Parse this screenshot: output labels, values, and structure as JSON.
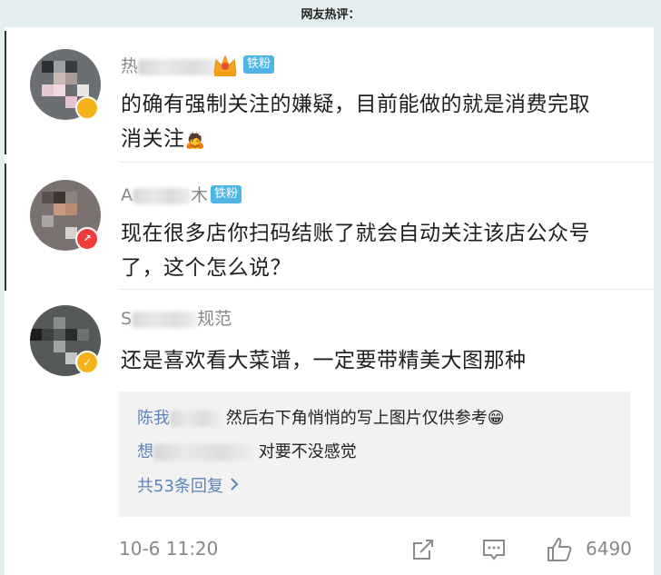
{
  "page": {
    "heading": "网友热评："
  },
  "comments": [
    {
      "name": "热",
      "badge": "铁粉",
      "text_line1": "的确有强制关注的嫌疑，目前能做的就是消费完取",
      "text_line2": "消关注",
      "emoji": "🙇"
    },
    {
      "name_start": "A",
      "name_end": "木",
      "badge": "铁粉",
      "text_line1": "现在很多店你扫码结账了就会自动关注该店公众号",
      "text_line2": "了，这个怎么说？"
    },
    {
      "name_start": "S",
      "name_end": "规范",
      "text": "还是喜欢看大菜谱，一定要带精美大图那种",
      "replies": [
        {
          "name": "陈我",
          "text": "然后右下角悄悄的写上图片仅供参考😁"
        },
        {
          "name": "想",
          "text": "对要不没感觉"
        }
      ],
      "more_replies": "共53条回复",
      "more_icon": "chevron-right-icon",
      "timestamp": "10-6 11:20",
      "like_count": "6490"
    }
  ],
  "icons": {
    "share": "share-icon",
    "comment": "comment-icon",
    "like": "thumbs-up-icon"
  },
  "colors": {
    "badge_bg": "#4eb5e6",
    "link": "#5d84b8",
    "page_bg": "#e3efee"
  }
}
